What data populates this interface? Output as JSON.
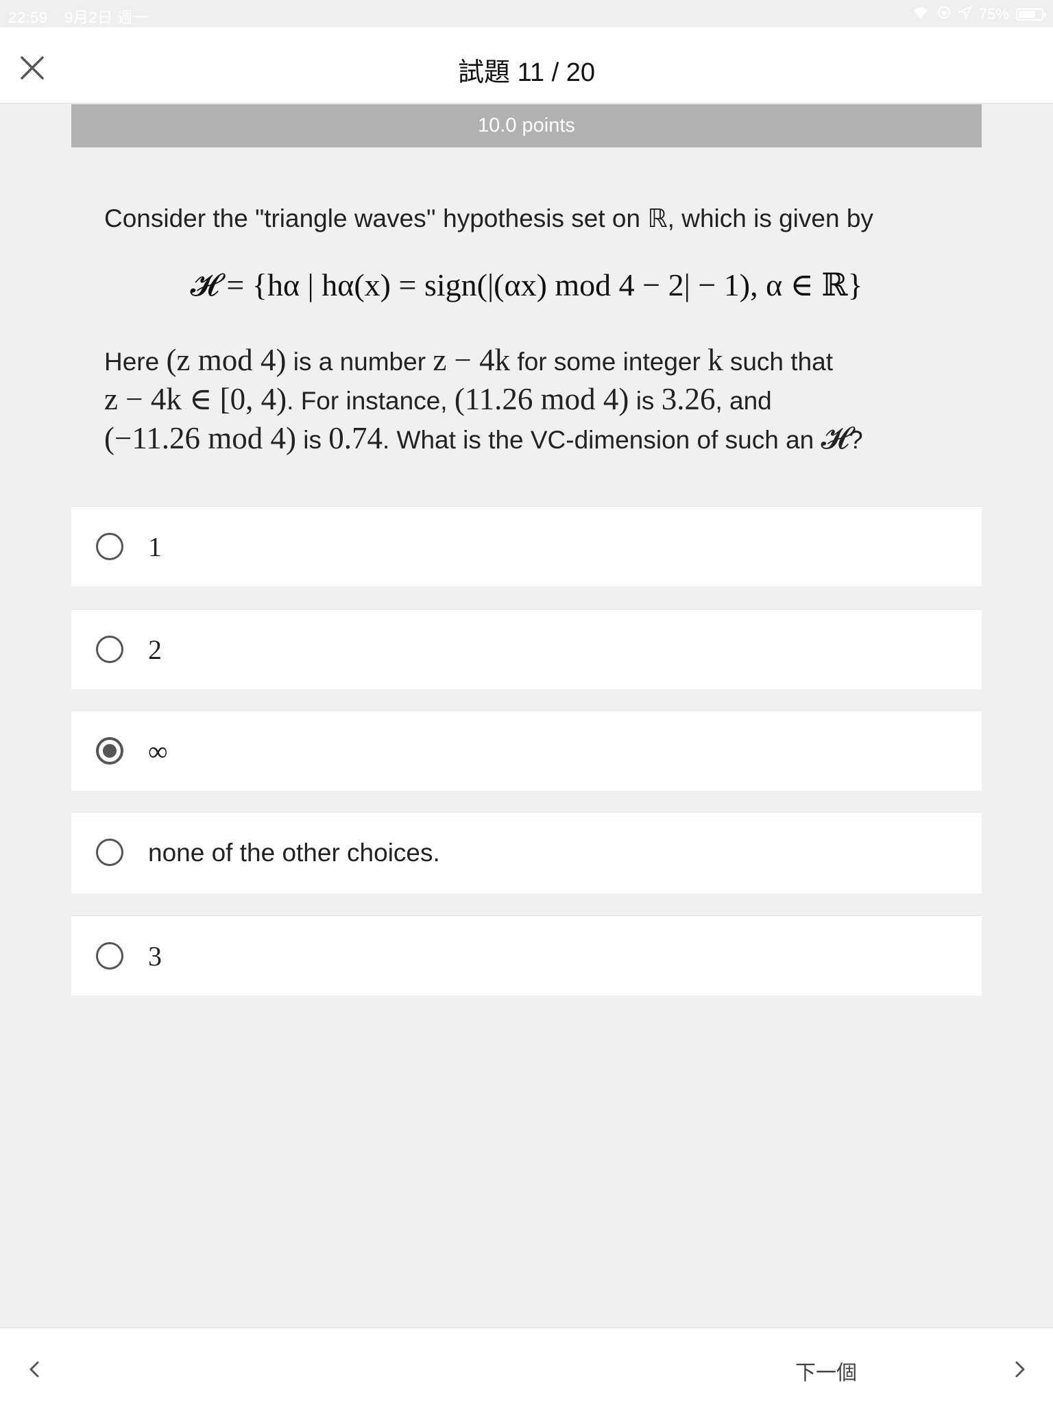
{
  "status_bar": {
    "time": "22:59",
    "date": "9月2日 週一",
    "battery": "75%",
    "battery_level": 0.75
  },
  "header": {
    "title": "試題 11 / 20"
  },
  "points": "10.0 points",
  "question": {
    "intro": "Consider the \"triangle waves'' hypothesis set on ℝ, which is given by",
    "formula": "𝓗 = {hα | hα(x) = sign(|(αx) mod 4 − 2| − 1), α ∈ ℝ}",
    "explain": {
      "p1": "Here ",
      "m1": "(z mod 4)",
      "p2": " is a number ",
      "m2": "z − 4k",
      "p3": " for some integer ",
      "m3": "k",
      "p4": " such that ",
      "m4": "z − 4k ∈ [0, 4)",
      "p5": ". For instance, ",
      "m5": "(11.26 mod 4)",
      "p6": " is ",
      "m6": "3.26",
      "p7": ", and ",
      "m7": "(−11.26 mod 4)",
      "p8": " is ",
      "m8": "0.74",
      "p9": ". What is the VC-dimension of such an ",
      "m9": "𝓗",
      "p10": "?"
    }
  },
  "choices": [
    {
      "label": "1",
      "selected": false
    },
    {
      "label": "2",
      "selected": false
    },
    {
      "label": "∞",
      "selected": true
    },
    {
      "label": "none of the other choices.",
      "selected": false
    },
    {
      "label": "3",
      "selected": false
    }
  ],
  "footer": {
    "next_label": "下一個"
  }
}
